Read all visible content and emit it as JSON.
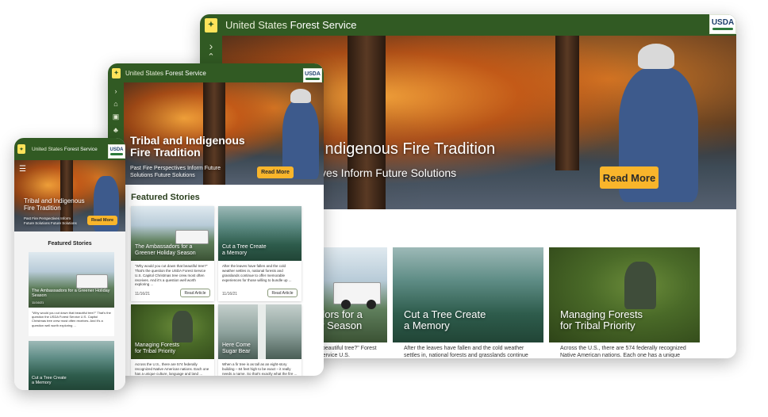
{
  "brand": {
    "prefix": "United States",
    "name": "Forest Service",
    "usda_label": "USDA",
    "badge_glyph": "✦"
  },
  "hero": {
    "title_line1": "Tribal and Indigenous",
    "title_line2": "Fire Tradition",
    "subtitle_line1": "Past Fire Perspectives Inform Future",
    "subtitle_line2": "Solutions Future Solutions",
    "desktop_title": "Indigenous Fire Tradition",
    "desktop_subtitle": "ves Inform Future Solutions",
    "phone_sub_line1": "Past Fire Perspectives Inform",
    "phone_sub_line2": "Future Solutions Future Solutions",
    "read_more": "Read More"
  },
  "featured": {
    "heading": "Featured Stories"
  },
  "stories": [
    {
      "title_line1": "The Ambassadors for a",
      "title_line2": "Greener Holiday Season",
      "desc": "\"Why would you cut down that beautiful tree?\" That's the question the USDA Forest Service U.S. Capitol Christmas tree crew most often receives. And it's a question well worth exploring ...",
      "date": "11/16/21",
      "action": "Read Article"
    },
    {
      "title_line1": "Cut a Tree Create",
      "title_line2": "a Memory",
      "desc": "After the leaves have fallen and the cold weather settles in, national forests and grasslands continue to offer memorable experiences for those willing to bundle up ...",
      "date": "11/16/21",
      "action": "Read Article"
    },
    {
      "title_line1": "Managing Forests",
      "title_line2": "for Tribal Priority",
      "desc": "Across the U.S., there are 574 federally recognized Native American nations. Each one has a unique culture, language and land ...",
      "date": "",
      "action": ""
    },
    {
      "title_line1": "Here Come",
      "title_line2": "Sugar Bear",
      "desc": "When a fir tree is as tall as an eight-story building – 84 feet high to be exact – it really needs a name. So that's exactly what the fire ...",
      "date": "",
      "action": ""
    }
  ],
  "desktop_cards": [
    {
      "title_line1": "dors for a",
      "title_line2": "y Season",
      "desc": "t beautiful tree?\" Forest Service U.S."
    },
    {
      "title_line1": "Cut a Tree Create",
      "title_line2": "a Memory",
      "desc": "After the leaves have fallen and the cold weather settles in, national forests and grasslands continue"
    },
    {
      "title_line1": "Managing Forests",
      "title_line2": "for Tribal Priority",
      "desc": "Across the U.S., there are 574 federally recognized Native American nations. Each one has a unique"
    }
  ],
  "phone_cards": [
    {
      "title": "The Ambassadors for a Greener Holiday Season",
      "date": "11/16/21",
      "desc": "\"Why would you cut down that beautiful tree?\" That's the question the USDA Forest Service U.S. Capitol Christmas tree crew most often receives. And it's a question well worth exploring ..."
    },
    {
      "title_line1": "Cut a Tree Create",
      "title_line2": "a Memory"
    }
  ],
  "colors": {
    "header_green": "#315a23",
    "button_gold": "#f9b52b",
    "heading_green": "#2a3f1e"
  },
  "icons": [
    "chevron-right-icon",
    "chevron-up-icon",
    "home-icon",
    "calendar-icon",
    "people-icon",
    "hamburger-menu-icon"
  ]
}
